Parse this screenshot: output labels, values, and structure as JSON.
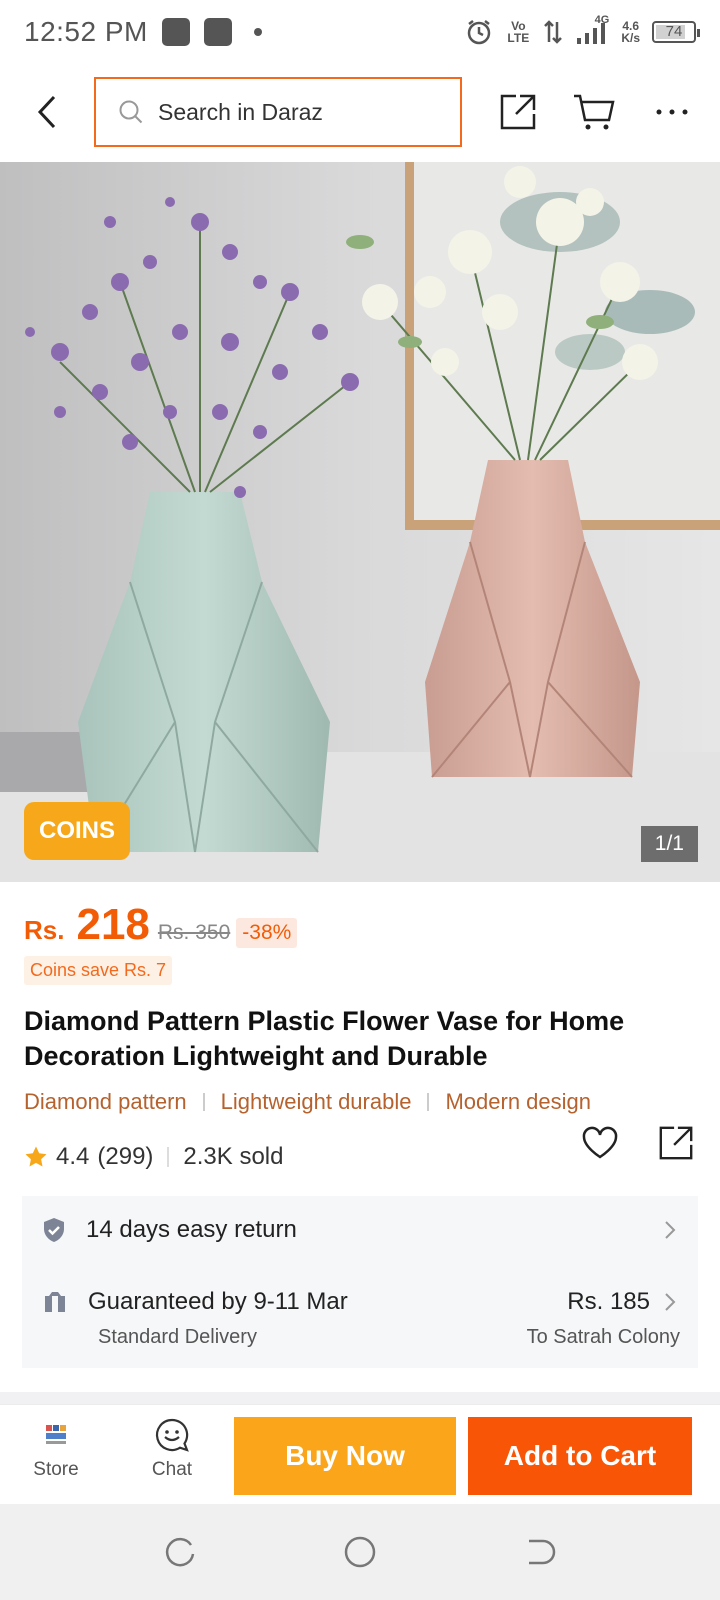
{
  "status_bar": {
    "time": "12:52 PM",
    "volte": "Vo LTE",
    "network": "4G",
    "speed_value": "4.6",
    "speed_unit": "K/s",
    "battery": "74"
  },
  "header": {
    "search_placeholder": "Search in Daraz"
  },
  "hero": {
    "coins_badge": "COINS",
    "image_counter": "1/1"
  },
  "price": {
    "currency": "Rs.",
    "current": "218",
    "original": "Rs. 350",
    "discount": "-38%",
    "coins_save": "Coins save Rs. 7"
  },
  "product": {
    "title": "Diamond Pattern Plastic Flower Vase for Home Decoration Lightweight and Durable",
    "tags": [
      "Diamond pattern",
      "Lightweight durable",
      "Modern design"
    ],
    "rating": "4.4",
    "reviews": "(299)",
    "sold": "2.3K sold"
  },
  "service": {
    "return_text": "14 days easy return",
    "delivery_text": "Guaranteed by 9-11 Mar",
    "delivery_type": "Standard Delivery",
    "delivery_price": "Rs. 185",
    "delivery_to": "To Satrah Colony"
  },
  "action_bar": {
    "store_label": "Store",
    "chat_label": "Chat",
    "buy_now": "Buy Now",
    "add_to_cart": "Add to Cart"
  },
  "colors": {
    "accent_orange": "#f85606",
    "buy_now_yellow": "#fba51a",
    "search_border": "#f36a1e",
    "tag_brown": "#b5622e",
    "star": "#f6a81a"
  },
  "icons": [
    "back-arrow-icon",
    "search-icon",
    "share-icon",
    "cart-icon",
    "more-icon",
    "star-icon",
    "heart-icon",
    "shield-icon",
    "truck-icon",
    "chevron-right-icon",
    "store-icon",
    "chat-icon"
  ]
}
